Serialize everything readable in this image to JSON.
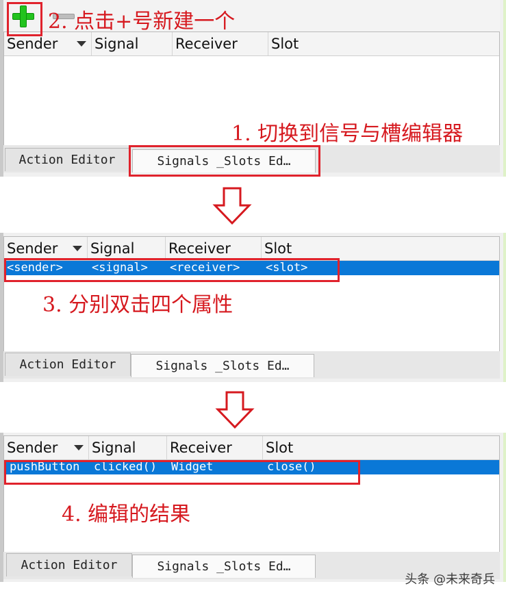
{
  "columns": [
    {
      "label": "Sender"
    },
    {
      "label": "Signal"
    },
    {
      "label": "Receiver"
    },
    {
      "label": "Slot"
    }
  ],
  "tabs": {
    "action_editor": "Action Editor",
    "signals_slots": "Signals _Slots Ed…"
  },
  "panel1": {
    "annotation_add": "2. 点击+号新建一个",
    "annotation_switch": "1. 切换到信号与槽编辑器"
  },
  "panel2": {
    "row": {
      "sender": "<sender>",
      "signal": "<signal>",
      "receiver": "<receiver>",
      "slot": "<slot>"
    },
    "annotation": "3. 分别双击四个属性"
  },
  "panel3": {
    "row": {
      "sender": "pushButton",
      "signal": "clicked()",
      "receiver": "Widget",
      "slot": "close()"
    },
    "annotation": "4. 编辑的结果"
  },
  "watermark": "头条 @未来奇兵",
  "colors": {
    "selection": "#0a78d7",
    "annotation_red": "#d6191f",
    "plus_green": "#22c31e"
  }
}
